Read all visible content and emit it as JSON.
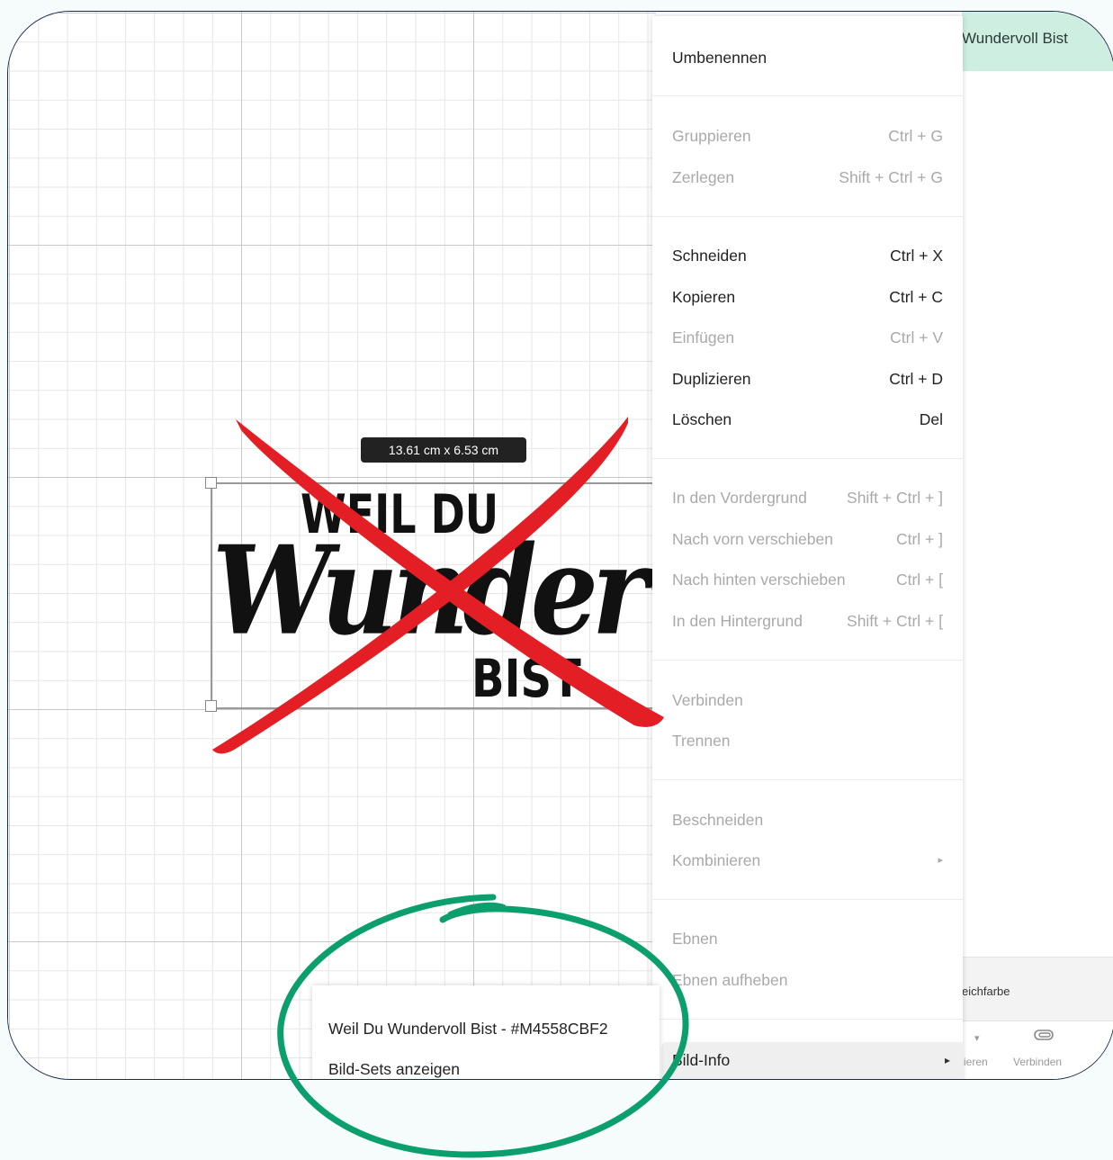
{
  "canvas": {
    "size_tooltip": "13.61 cm x 6.53 cm",
    "design_lines": [
      "WEIL DU",
      "Wundervoll",
      "BIST"
    ]
  },
  "right_panel": {
    "title": "Wundervoll Bist",
    "fill_label": "eichfarbe",
    "tools": [
      "ieren",
      "Verbinden"
    ]
  },
  "context_menu": {
    "rename": "Umbenennen",
    "items": [
      {
        "label": "Gruppieren",
        "shortcut": "Ctrl + G",
        "enabled": false
      },
      {
        "label": "Zerlegen",
        "shortcut": "Shift + Ctrl + G",
        "enabled": false
      },
      {
        "label": "Schneiden",
        "shortcut": "Ctrl + X",
        "enabled": true
      },
      {
        "label": "Kopieren",
        "shortcut": "Ctrl + C",
        "enabled": true
      },
      {
        "label": "Einfügen",
        "shortcut": "Ctrl + V",
        "enabled": false
      },
      {
        "label": "Duplizieren",
        "shortcut": "Ctrl + D",
        "enabled": true
      },
      {
        "label": "Löschen",
        "shortcut": "Del",
        "enabled": true
      },
      {
        "label": "In den Vordergrund",
        "shortcut": "Shift + Ctrl + ]",
        "enabled": false
      },
      {
        "label": "Nach vorn verschieben",
        "shortcut": "Ctrl + ]",
        "enabled": false
      },
      {
        "label": "Nach hinten verschieben",
        "shortcut": "Ctrl + [",
        "enabled": false
      },
      {
        "label": "In den Hintergrund",
        "shortcut": "Shift + Ctrl + [",
        "enabled": false
      },
      {
        "label": "Verbinden",
        "shortcut": "",
        "enabled": false
      },
      {
        "label": "Trennen",
        "shortcut": "",
        "enabled": false
      },
      {
        "label": "Beschneiden",
        "shortcut": "",
        "enabled": false
      },
      {
        "label": "Kombinieren",
        "shortcut": "▸",
        "enabled": false
      },
      {
        "label": "Ebnen",
        "shortcut": "",
        "enabled": false
      },
      {
        "label": "Ebnen aufheben",
        "shortcut": "",
        "enabled": false
      }
    ],
    "bild_info": "Bild-Info",
    "bild_info_arrow": "▸"
  },
  "submenu": {
    "items": [
      "Weil Du Wundervoll Bist - #M4558CBF2",
      "Bild-Sets anzeigen"
    ]
  },
  "annotations": {
    "cross_color": "#e31e25",
    "circle_color": "#0c9f6e"
  }
}
